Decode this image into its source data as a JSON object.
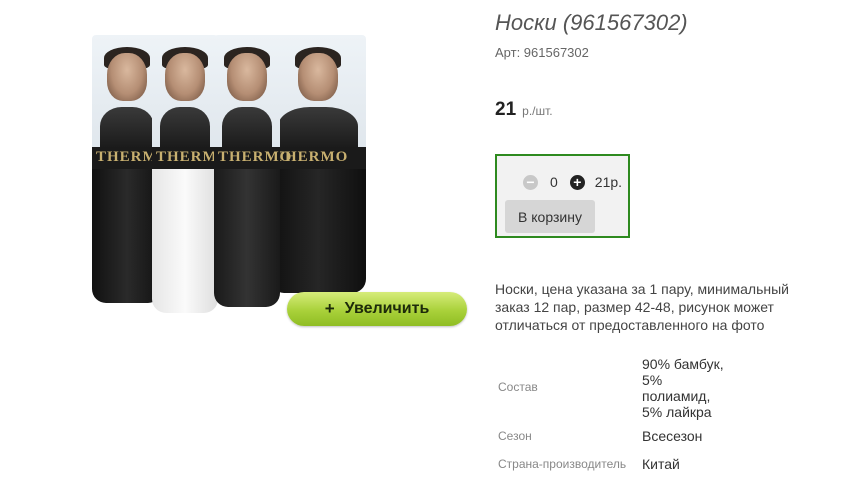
{
  "product": {
    "title": "Носки (961567302)",
    "sku": "Арт: 961567302",
    "price": "21",
    "price_unit": "р./шт.",
    "description": "Носки, цена указана за 1 пару, минимальный заказ 12 пар, размер 42-48, рисунок может отличаться от предоставленного на фото",
    "band_text": "THERMO"
  },
  "image": {
    "zoom_label": "Увеличить",
    "zoom_icon": "+"
  },
  "cart": {
    "minus_icon": "−",
    "quantity": "0",
    "plus_icon": "+",
    "total": "21р.",
    "add_button": "В корзину",
    "border_color": "#2e8a1f"
  },
  "properties": [
    {
      "name": "Состав",
      "value": "90% бамбук, 5% полиамид, 5% лайкра"
    },
    {
      "name": "Сезон",
      "value": "Всесезон"
    },
    {
      "name": "Страна-производитель",
      "value": "Китай"
    }
  ]
}
